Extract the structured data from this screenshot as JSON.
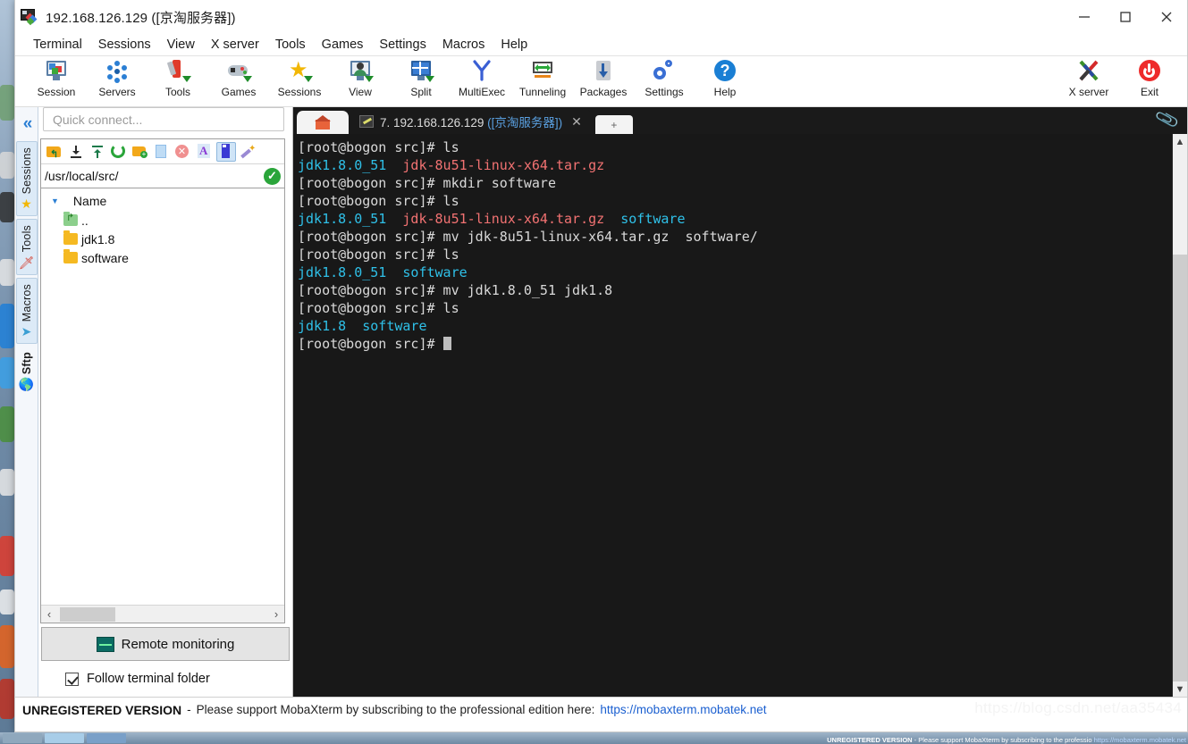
{
  "window": {
    "title": "192.168.126.129 ([京淘服务器])",
    "icon": "mobaxterm-logo-icon",
    "controls": {
      "minimize": "—",
      "maximize": "□",
      "close": "✕"
    }
  },
  "menubar": {
    "items": [
      "Terminal",
      "Sessions",
      "View",
      "X server",
      "Tools",
      "Games",
      "Settings",
      "Macros",
      "Help"
    ]
  },
  "toolbar": {
    "left_buttons": [
      {
        "label": "Session",
        "icon": "session-icon"
      },
      {
        "label": "Servers",
        "icon": "servers-icon"
      },
      {
        "label": "Tools",
        "icon": "tools-icon"
      },
      {
        "label": "Games",
        "icon": "games-icon"
      },
      {
        "label": "Sessions",
        "icon": "sessions-star-icon"
      },
      {
        "label": "View",
        "icon": "view-icon"
      },
      {
        "label": "Split",
        "icon": "split-icon"
      },
      {
        "label": "MultiExec",
        "icon": "multiexec-icon"
      },
      {
        "label": "Tunneling",
        "icon": "tunneling-icon"
      },
      {
        "label": "Packages",
        "icon": "packages-icon"
      },
      {
        "label": "Settings",
        "icon": "settings-gear-icon"
      },
      {
        "label": "Help",
        "icon": "help-question-icon"
      }
    ],
    "right_buttons": [
      {
        "label": "X server",
        "icon": "x-server-icon"
      },
      {
        "label": "Exit",
        "icon": "exit-power-icon"
      }
    ]
  },
  "quick_connect": {
    "placeholder": "Quick connect..."
  },
  "side_tabs": [
    {
      "label": "Sessions",
      "icon": "star-icon",
      "bold": false
    },
    {
      "label": "Tools",
      "icon": "swiss-knife-icon",
      "bold": false
    },
    {
      "label": "Macros",
      "icon": "paper-plane-icon",
      "bold": false
    },
    {
      "label": "Sftp",
      "icon": "globe-icon",
      "bold": true
    }
  ],
  "sftp": {
    "toolbar_icons": [
      "go-up-folder-icon",
      "download-icon",
      "upload-icon",
      "refresh-icon",
      "new-folder-icon",
      "new-file-icon",
      "delete-icon",
      "text-mode-icon",
      "binary-mode-icon",
      "permissions-icon"
    ],
    "selected_toolbar_icon_index": 8,
    "path": "/usr/local/src/",
    "path_status": "connected-ok",
    "column_header": "Name",
    "rows": [
      {
        "name": "..",
        "type": "parent-folder"
      },
      {
        "name": "jdk1.8",
        "type": "folder"
      },
      {
        "name": "software",
        "type": "folder"
      }
    ],
    "remote_monitoring_label": "Remote monitoring",
    "follow_terminal_label": "Follow terminal folder",
    "follow_terminal_checked": true
  },
  "tabs": {
    "home_tab_icon": "home-icon",
    "active": {
      "icon": "ssh-key-icon",
      "index": "7.",
      "host": "192.168.126.129",
      "suffix": "([京淘服务器])",
      "close": "✕"
    },
    "new_tab": "+",
    "clip_icon": "paperclip-icon"
  },
  "terminal": {
    "prompt": "[root@bogon src]# ",
    "colors": {
      "fg": "#d9d9d9",
      "dir": "#2fc0e8",
      "archive": "#f27272",
      "bg": "#181818"
    },
    "lines": [
      [
        {
          "t": "[root@bogon src]# ls",
          "c": "white"
        }
      ],
      [
        {
          "t": "jdk1.8.0_51",
          "c": "cyan"
        },
        {
          "t": "  ",
          "c": "white"
        },
        {
          "t": "jdk-8u51-linux-x64.tar.gz",
          "c": "red"
        }
      ],
      [
        {
          "t": "[root@bogon src]# mkdir software",
          "c": "white"
        }
      ],
      [
        {
          "t": "[root@bogon src]# ls",
          "c": "white"
        }
      ],
      [
        {
          "t": "jdk1.8.0_51",
          "c": "cyan"
        },
        {
          "t": "  ",
          "c": "white"
        },
        {
          "t": "jdk-8u51-linux-x64.tar.gz",
          "c": "red"
        },
        {
          "t": "  ",
          "c": "white"
        },
        {
          "t": "software",
          "c": "cyan"
        }
      ],
      [
        {
          "t": "[root@bogon src]# mv jdk-8u51-linux-x64.tar.gz  software/",
          "c": "white"
        }
      ],
      [
        {
          "t": "[root@bogon src]# ls",
          "c": "white"
        }
      ],
      [
        {
          "t": "jdk1.8.0_51",
          "c": "cyan"
        },
        {
          "t": "  ",
          "c": "white"
        },
        {
          "t": "software",
          "c": "cyan"
        }
      ],
      [
        {
          "t": "[root@bogon src]# mv jdk1.8.0_51 jdk1.8",
          "c": "white"
        }
      ],
      [
        {
          "t": "[root@bogon src]# ls",
          "c": "white"
        }
      ],
      [
        {
          "t": "jdk1.8",
          "c": "cyan"
        },
        {
          "t": "  ",
          "c": "white"
        },
        {
          "t": "software",
          "c": "cyan"
        }
      ],
      [
        {
          "t": "[root@bogon src]# ",
          "c": "white"
        },
        {
          "t": "",
          "c": "cursor"
        }
      ]
    ]
  },
  "status_bar": {
    "strong": "UNREGISTERED VERSION",
    "dash": "-",
    "text": "Please support MobaXterm by subscribing to the professional edition here:",
    "link": "https://mobaxterm.mobatek.net"
  },
  "watermark": "https://blog.csdn.net/aa35434",
  "taskbar_notice": {
    "strong": "UNREGISTERED VERSION",
    "text": " - Please support MobaXterm by subscribing to the professio",
    "link": "https://mobaxterm.mobatek.net"
  }
}
